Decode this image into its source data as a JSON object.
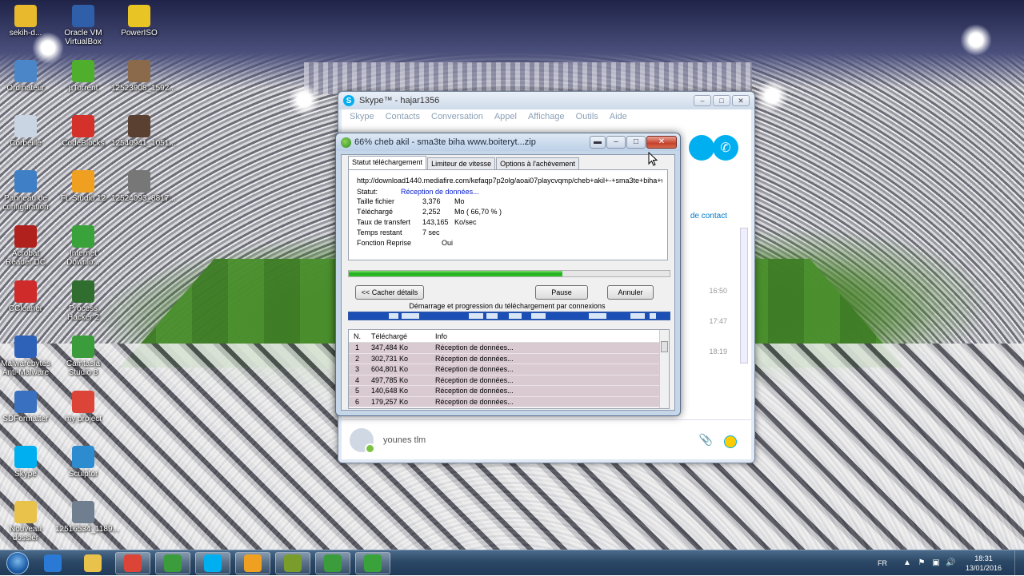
{
  "desktop": {
    "icons": [
      {
        "label": "sekih-d...",
        "color": "#e8b92d"
      },
      {
        "label": "Oracle VM VirtualBox",
        "color": "#2f5fa8"
      },
      {
        "label": "PowerISO",
        "color": "#e9c425"
      },
      {
        "label": "Ordinateur",
        "color": "#4a86c8"
      },
      {
        "label": "µTorrent",
        "color": "#4fae2b"
      },
      {
        "label": "12523908_1592...",
        "color": "#8a6a4a"
      },
      {
        "label": "Corbeille",
        "color": "#c9d5e2"
      },
      {
        "label": "CodeBlocks",
        "color": "#d4312a"
      },
      {
        "label": "12540941_1051...",
        "color": "#5a4030"
      },
      {
        "label": "Panneau de configuration",
        "color": "#3f7fc5"
      },
      {
        "label": "FL Studio 12",
        "color": "#f0a020"
      },
      {
        "label": "12524093_8817...",
        "color": "#777"
      },
      {
        "label": "Acrobat Reader DC",
        "color": "#b0201c"
      },
      {
        "label": "Internet Downlo...",
        "color": "#3aa23a"
      },
      {
        "label": "CCleaner",
        "color": "#cf2b2b"
      },
      {
        "label": "Process Hacker 2",
        "color": "#2f6e2f"
      },
      {
        "label": "Malwarebytes Anti-Malware",
        "color": "#2d62b8"
      },
      {
        "label": "Camtasia Studio 8",
        "color": "#3b9c3b"
      },
      {
        "label": "SDFormatter",
        "color": "#3a70c0"
      },
      {
        "label": "my project",
        "color": "#db4437"
      },
      {
        "label": "Skype",
        "color": "#00aff0"
      },
      {
        "label": "Sculptor",
        "color": "#2d8bd0"
      },
      {
        "label": "Nouveau dossier",
        "color": "#e8c24a"
      },
      {
        "label": "12516534_1189...",
        "color": "#6f7f90"
      }
    ]
  },
  "skype": {
    "title": "Skype™ - hajar1356",
    "menu": [
      "Skype",
      "Contacts",
      "Conversation",
      "Appel",
      "Affichage",
      "Outils",
      "Aide"
    ],
    "add_contact": "de contact",
    "times": [
      "16:50",
      "17:47",
      "18:19"
    ],
    "contact_name": "younes tlm"
  },
  "download": {
    "title": "66% cheb akil - sma3te biha www.boiteryt...zip",
    "tabs": [
      "Statut téléchargement",
      "Limiteur de vitesse",
      "Options à l'achèvement"
    ],
    "url": "http://download1440.mediafire.com/kefaqp7p2olg/aoai07playcvqmp/cheb+akil+-+sma3te+biha+www",
    "status_label": "Statut:",
    "status_value": "Réception de données...",
    "file_size_label": "Taille fichier",
    "file_size_value": "3,376",
    "file_size_unit": "Mo",
    "downloaded_label": "Téléchargé",
    "downloaded_value": "2,252",
    "downloaded_unit": "Mo  ( 66,70 % )",
    "rate_label": "Taux de transfert",
    "rate_value": "143,165",
    "rate_unit": "Ko/sec",
    "remaining_label": "Temps restant",
    "remaining_value": "7 sec",
    "resume_label": "Fonction Reprise",
    "resume_value": "Oui",
    "progress": 0.667,
    "hide_details": "<< Cacher détails",
    "pause": "Pause",
    "cancel": "Annuler",
    "connections_title": "Démarrage et progression du téléchargement par connexions",
    "columns": [
      "N.",
      "Téléchargé",
      "Info"
    ],
    "rows": [
      {
        "n": "1",
        "downloaded": "347,484 Ko",
        "info": "Réception de données..."
      },
      {
        "n": "2",
        "downloaded": "302,731 Ko",
        "info": "Réception de données..."
      },
      {
        "n": "3",
        "downloaded": "604,801 Ko",
        "info": "Réception de données..."
      },
      {
        "n": "4",
        "downloaded": "497,785 Ko",
        "info": "Réception de données..."
      },
      {
        "n": "5",
        "downloaded": "140,648 Ko",
        "info": "Réception de données..."
      },
      {
        "n": "6",
        "downloaded": "179,257 Ko",
        "info": "Réception de données..."
      }
    ]
  },
  "taskbar": {
    "apps": [
      {
        "name": "ie",
        "color": "#2a79d4"
      },
      {
        "name": "explorer",
        "color": "#e8c24a"
      },
      {
        "name": "chrome",
        "color": "#db4437"
      },
      {
        "name": "screen-capture",
        "color": "#3b9c3b"
      },
      {
        "name": "skype",
        "color": "#00aff0"
      },
      {
        "name": "fl-studio",
        "color": "#f0a020"
      },
      {
        "name": "chart-app",
        "color": "#7a9c2a"
      },
      {
        "name": "camtasia",
        "color": "#3b9c3b"
      },
      {
        "name": "idm",
        "color": "#3aa23a"
      }
    ],
    "language": "FR",
    "time": "18:31",
    "date": "13/01/2016"
  }
}
